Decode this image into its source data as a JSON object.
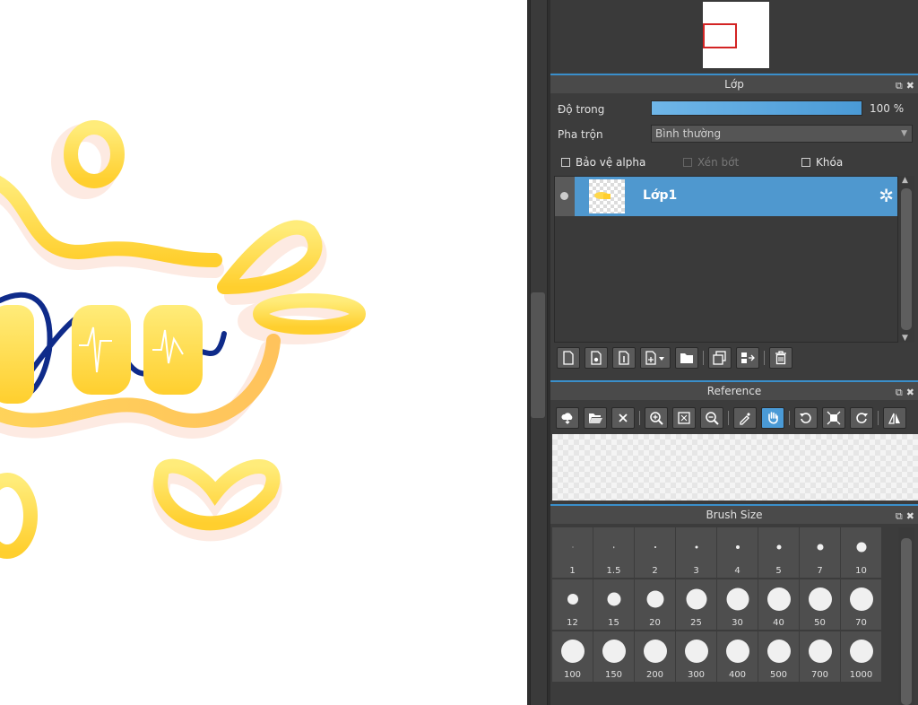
{
  "layer_panel": {
    "title": "Lớp",
    "opacity_label": "Độ trong",
    "opacity_value": "100 %",
    "opacity_level": 1.0,
    "blend_label": "Pha trộn",
    "blend_value": "Bình thường",
    "protect_alpha_label": "Bảo vệ alpha",
    "clipping_label": "Xén bớt",
    "lock_label": "Khóa",
    "layers": [
      {
        "name": "Lớp1",
        "selected": true
      }
    ]
  },
  "reference_panel": {
    "title": "Reference"
  },
  "brush_panel": {
    "title": "Brush Size",
    "sizes": [
      {
        "label": "1",
        "value": 1
      },
      {
        "label": "1.5",
        "value": 1.5
      },
      {
        "label": "2",
        "value": 2
      },
      {
        "label": "3",
        "value": 3
      },
      {
        "label": "4",
        "value": 4
      },
      {
        "label": "5",
        "value": 5
      },
      {
        "label": "7",
        "value": 7
      },
      {
        "label": "10",
        "value": 10
      },
      {
        "label": "12",
        "value": 12
      },
      {
        "label": "15",
        "value": 15
      },
      {
        "label": "20",
        "value": 20
      },
      {
        "label": "25",
        "value": 25
      },
      {
        "label": "30",
        "value": 30
      },
      {
        "label": "40",
        "value": 40
      },
      {
        "label": "50",
        "value": 50
      },
      {
        "label": "70",
        "value": 70
      },
      {
        "label": "100",
        "value": 100
      },
      {
        "label": "150",
        "value": 150
      },
      {
        "label": "200",
        "value": 200
      },
      {
        "label": "300",
        "value": 300
      },
      {
        "label": "400",
        "value": 400
      },
      {
        "label": "500",
        "value": 500
      },
      {
        "label": "700",
        "value": 700
      },
      {
        "label": "1000",
        "value": 1000
      }
    ]
  },
  "icons": {
    "layer_toolbar": [
      "new-layer-icon",
      "new-halftone-layer-icon",
      "new-1bit-layer-icon",
      "add-layer-menu-icon",
      "folder-icon",
      "duplicate-layer-icon",
      "merge-layer-icon",
      "delete-layer-icon"
    ],
    "reference_toolbar": [
      "load-cloud-icon",
      "open-folder-icon",
      "close-icon",
      "zoom-in-icon",
      "fit-icon",
      "zoom-out-icon",
      "eyedropper-icon",
      "hand-icon",
      "rotate-left-icon",
      "actual-size-icon",
      "rotate-right-icon",
      "flip-icon"
    ],
    "panel_header": [
      "float-window-icon",
      "close-panel-icon"
    ]
  },
  "colors": {
    "accent": "#4f98cf",
    "panel_bg": "#3c3c3c",
    "header_line": "#3a8fcb"
  }
}
